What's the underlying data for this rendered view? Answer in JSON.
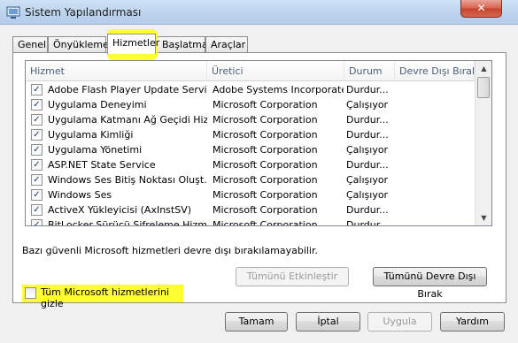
{
  "window": {
    "title": "Sistem Yapılandırması",
    "close_symbol": "✕"
  },
  "tabs": [
    "Genel",
    "Önyükleme",
    "Hizmetler",
    "Başlatma",
    "Araçlar"
  ],
  "active_tab": 2,
  "columns": [
    "Hizmet",
    "Üretici",
    "Durum",
    "Devre Dışı Bırakı..."
  ],
  "services": [
    {
      "name": "Adobe Flash Player Update Service",
      "vendor": "Adobe Systems Incorporated",
      "status": "Durdur..."
    },
    {
      "name": "Uygulama Deneyimi",
      "vendor": "Microsoft Corporation",
      "status": "Çalışıyor"
    },
    {
      "name": "Uygulama Katmanı Ağ Geçidi Hiz...",
      "vendor": "Microsoft Corporation",
      "status": "Durdur..."
    },
    {
      "name": "Uygulama Kimliği",
      "vendor": "Microsoft Corporation",
      "status": "Durdur..."
    },
    {
      "name": "Uygulama Yönetimi",
      "vendor": "Microsoft Corporation",
      "status": "Çalışıyor"
    },
    {
      "name": "ASP.NET State Service",
      "vendor": "Microsoft Corporation",
      "status": "Durdur..."
    },
    {
      "name": "Windows Ses Bitiş Noktası Oluşt...",
      "vendor": "Microsoft Corporation",
      "status": "Çalışıyor"
    },
    {
      "name": "Windows Ses",
      "vendor": "Microsoft Corporation",
      "status": "Çalışıyor"
    },
    {
      "name": "ActiveX Yükleyicisi (AxInstSV)",
      "vendor": "Microsoft Corporation",
      "status": "Durdur..."
    },
    {
      "name": "BitLocker Sürücü Şifreleme Hizmeti",
      "vendor": "Microsoft Corporation",
      "status": "Durdur..."
    }
  ],
  "info_text": "Bazı güvenli Microsoft hizmetleri devre dışı bırakılamayabilir.",
  "buttons": {
    "enable_all": "Tümünü Etkinleştir",
    "disable_all": "Tümünü Devre Dışı Bırak",
    "ok": "Tamam",
    "cancel": "İptal",
    "apply": "Uygula",
    "help": "Yardım"
  },
  "hide_ms_label": "Tüm Microsoft hizmetlerini gizle",
  "checkmark": "✓",
  "highlight_color": "#ffff33"
}
